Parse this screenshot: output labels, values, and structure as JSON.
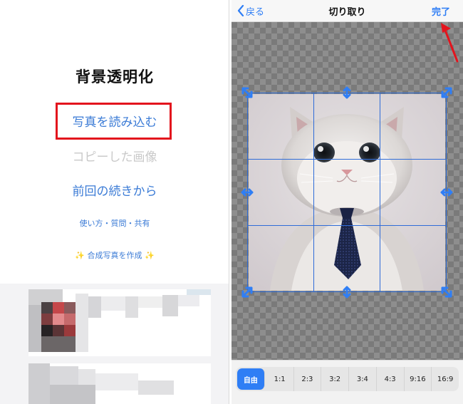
{
  "left_panel": {
    "title": "背景透明化",
    "menu": {
      "load_photo": "写真を読み込む",
      "copied_image": "コピーした画像",
      "resume": "前回の続きから",
      "usage": "使い方・質問・共有",
      "compose_sparkle": "✨",
      "compose": "合成写真を作成"
    }
  },
  "right_panel": {
    "navbar": {
      "back_label": "戻る",
      "title": "切り取り",
      "done_label": "完了"
    },
    "aspect_ratios": [
      {
        "label": "自由",
        "selected": true
      },
      {
        "label": "1:1",
        "selected": false
      },
      {
        "label": "2:3",
        "selected": false
      },
      {
        "label": "3:2",
        "selected": false
      },
      {
        "label": "3:4",
        "selected": false
      },
      {
        "label": "4:3",
        "selected": false
      },
      {
        "label": "9:16",
        "selected": false
      },
      {
        "label": "16:9",
        "selected": false
      }
    ]
  },
  "colors": {
    "accent_blue": "#2f7ef5",
    "link_blue": "#3b7bd6",
    "highlight_red": "#e3141d",
    "disabled_gray": "#c9c9c9"
  },
  "icons": {
    "back": "chevron-left-icon",
    "crop_corner": "diagonal-resize-icon",
    "crop_edge": "resize-arrow-icon",
    "annotation": "red-arrow-icon"
  }
}
